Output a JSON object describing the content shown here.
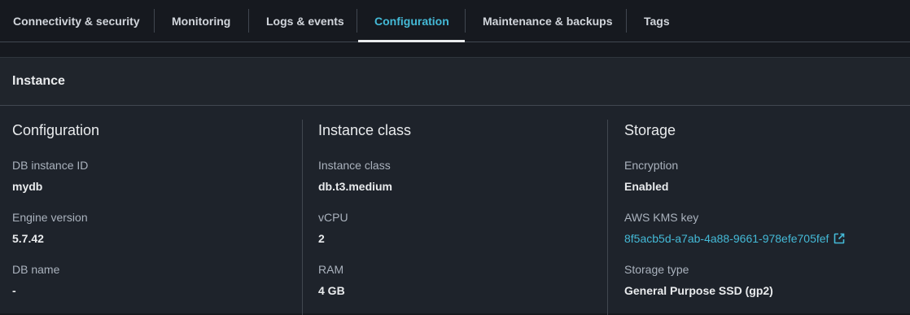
{
  "tabs": [
    {
      "label": "Connectivity & security"
    },
    {
      "label": "Monitoring"
    },
    {
      "label": "Logs & events"
    },
    {
      "label": "Configuration"
    },
    {
      "label": "Maintenance & backups"
    },
    {
      "label": "Tags"
    }
  ],
  "active_tab": "Configuration",
  "panel": {
    "title": "Instance"
  },
  "columns": [
    {
      "title": "Configuration",
      "fields": [
        {
          "label": "DB instance ID",
          "value": "mydb"
        },
        {
          "label": "Engine version",
          "value": "5.7.42"
        },
        {
          "label": "DB name",
          "value": "-"
        }
      ]
    },
    {
      "title": "Instance class",
      "fields": [
        {
          "label": "Instance class",
          "value": "db.t3.medium"
        },
        {
          "label": "vCPU",
          "value": "2"
        },
        {
          "label": "RAM",
          "value": "4 GB"
        }
      ]
    },
    {
      "title": "Storage",
      "fields": [
        {
          "label": "Encryption",
          "value": "Enabled"
        },
        {
          "label": "AWS KMS key",
          "value": "8f5acb5d-a7ab-4a88-9661-978efe705fef"
        },
        {
          "label": "Storage type",
          "value": "General Purpose SSD (gp2)"
        }
      ]
    }
  ],
  "colors": {
    "accent": "#44b9d6",
    "background": "#16191f"
  }
}
